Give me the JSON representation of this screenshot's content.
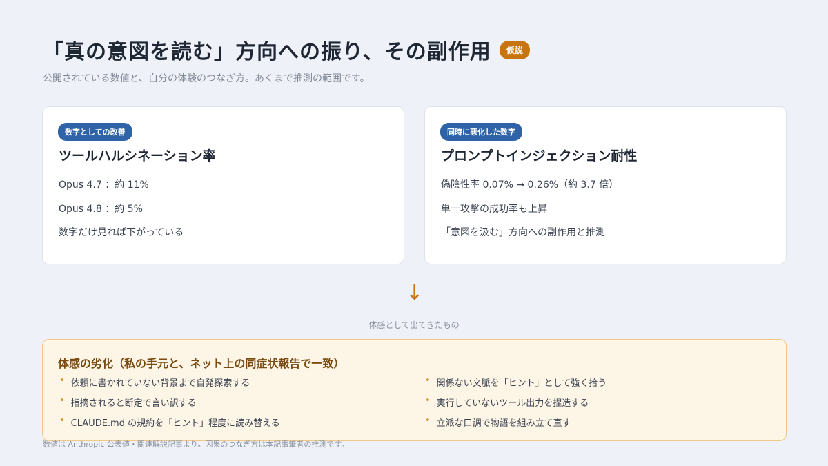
{
  "header": {
    "title": "「真の意図を読む」方向への振り、その副作用",
    "badge": "仮説",
    "subtitle": "公開されている数値と、自分の体験のつなぎ方。あくまで推測の範囲です。"
  },
  "cards": [
    {
      "badge": "数字としての改善",
      "title": "ツールハルシネーション率",
      "lines": [
        "Opus 4.7 ：約 11%",
        "Opus 4.8 ：約 5%",
        "数字だけ見れば下がっている"
      ]
    },
    {
      "badge": "同時に悪化した数字",
      "title": "プロンプトインジェクション耐性",
      "lines": [
        "偽陰性率 0.07% → 0.26%（約 3.7 倍）",
        "単一攻撃の成功率も上昇",
        "「意図を汲む」方向への副作用と推測"
      ]
    }
  ],
  "connector": {
    "arrow": "↓",
    "label": "体感として出てきたもの"
  },
  "panel": {
    "title": "体感の劣化（私の手元と、ネット上の同症状報告で一致）",
    "left_items": [
      "依頼に書かれていない背景まで自発探索する",
      "指摘されると断定で言い訳する",
      "CLAUDE.md の規約を「ヒント」程度に読み替える"
    ],
    "right_items": [
      "関係ない文脈を「ヒント」として強く拾う",
      "実行していないツール出力を捏造する",
      "立派な口調で物語を組み立て直す"
    ],
    "bullet": "•"
  },
  "footnote": "数値は Anthropic 公表値・関連解説記事より。因果のつなぎ方は本記事筆者の推測です。",
  "colors": {
    "background": "#eef1f7",
    "accent_orange": "#c8750f",
    "badge_blue": "#2f63a8",
    "panel_bg": "#fdf5e6",
    "panel_border": "#efc98a"
  }
}
